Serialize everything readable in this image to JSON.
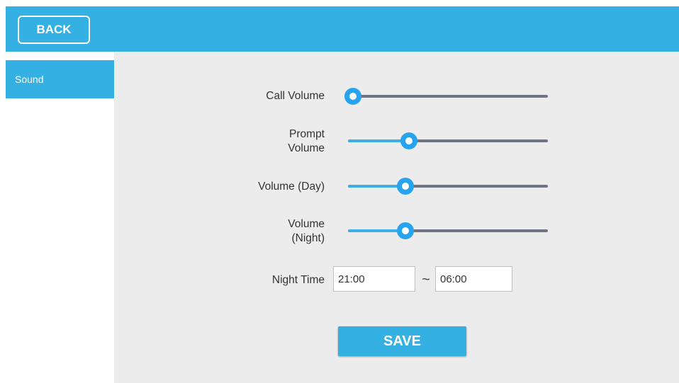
{
  "header": {
    "back_label": "BACK"
  },
  "sidebar": {
    "items": [
      {
        "label": "Sound"
      }
    ]
  },
  "settings": {
    "sliders": [
      {
        "label": "Call Volume",
        "value": 0.0
      },
      {
        "label": "Prompt Volume",
        "value": 0.29
      },
      {
        "label": "Volume (Day)",
        "value": 0.27
      },
      {
        "label": "Volume (Night)",
        "value": 0.27
      }
    ],
    "night_time": {
      "label": "Night Time",
      "start": "21:00",
      "separator": "~",
      "end": "06:00"
    },
    "save_label": "SAVE"
  },
  "colors": {
    "accent": "#34b1e2",
    "slider_active": "#3daee8",
    "slider_inactive": "#6f7480",
    "background": "#ececec"
  }
}
